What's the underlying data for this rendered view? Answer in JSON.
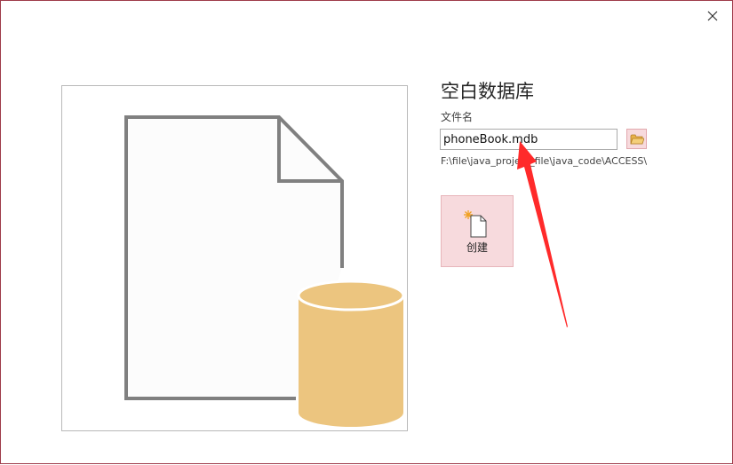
{
  "dialog": {
    "title": "空白数据库",
    "close_icon": "close-icon",
    "accent_color": "#9e3b4a"
  },
  "preview": {
    "icon": "blank-database-icon",
    "document_color": "#808080",
    "database_color": "#ecc57f"
  },
  "form": {
    "filename_label": "文件名",
    "filename_value": "phoneBook.mdb",
    "browse_icon": "folder-icon",
    "path": "F:\\file\\java_project_file\\java_code\\ACCESS\\"
  },
  "create_button": {
    "label": "创建",
    "icon": "new-document-icon",
    "background_color": "#f7dadd"
  },
  "annotation": {
    "icon": "red-arrow-annotation",
    "color": "#ff2a2a"
  }
}
